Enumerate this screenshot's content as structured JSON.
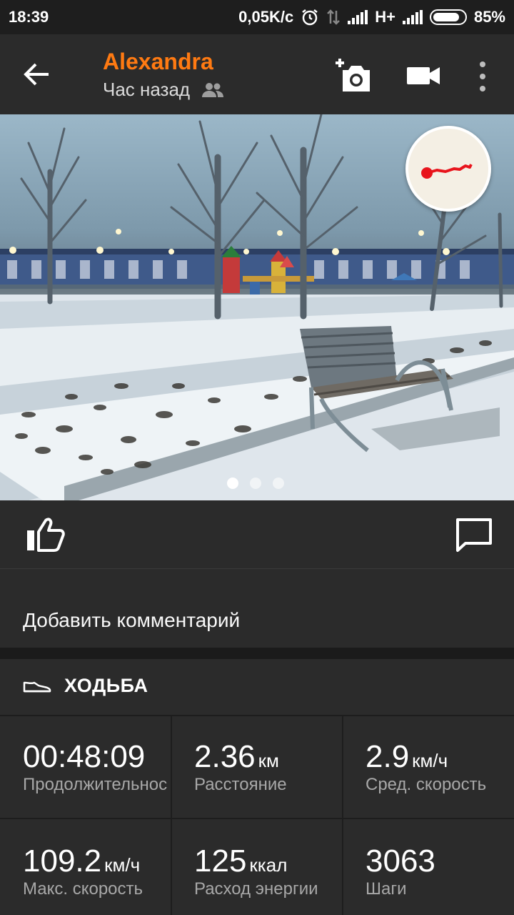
{
  "status_bar": {
    "time": "18:39",
    "net_speed": "0,05K/c",
    "network": "H+",
    "battery": "85%"
  },
  "header": {
    "user_name": "Alexandra",
    "time_ago": "Час назад",
    "icons": [
      "back-arrow-icon",
      "people-icon",
      "add-photo-icon",
      "video-camera-icon",
      "more-vert-icon"
    ]
  },
  "photo": {
    "carousel_total": 3,
    "carousel_active": 1
  },
  "actions": {
    "icons": [
      "thumb-up-icon",
      "comment-icon"
    ]
  },
  "comment": {
    "placeholder": "Добавить комментарий"
  },
  "workout": {
    "type": "ХОДЬБА",
    "icon": "shoe-icon",
    "stats": [
      {
        "value": "00:48:09",
        "unit": "",
        "label": "Продолжительнос"
      },
      {
        "value": "2.36",
        "unit": "км",
        "label": "Расстояние"
      },
      {
        "value": "2.9",
        "unit": "км/ч",
        "label": "Сред. скорость"
      },
      {
        "value": "109.2",
        "unit": "км/ч",
        "label": "Макс. скорость"
      },
      {
        "value": "125",
        "unit": "ккал",
        "label": "Расход энергии"
      },
      {
        "value": "3063",
        "unit": "",
        "label": "Шаги"
      }
    ]
  },
  "colors": {
    "accent": "#ff7a12",
    "background": "#2b2b2b",
    "route": "#e8141c"
  }
}
